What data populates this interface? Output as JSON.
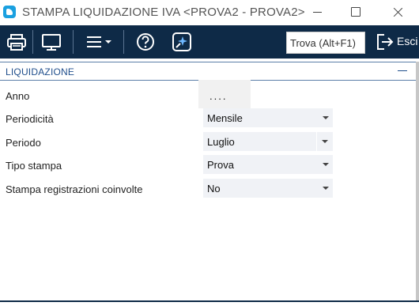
{
  "window": {
    "title": "STAMPA LIQUIDAZIONE IVA <PROVA2 - PROVA2>"
  },
  "toolbar": {
    "buttons": [
      {
        "icon": "printer-icon"
      },
      {
        "icon": "monitor-icon"
      },
      {
        "icon": "menu-icon"
      },
      {
        "icon": "help-icon"
      },
      {
        "icon": "magic-icon"
      }
    ],
    "search_placeholder": "Trova (Alt+F1)",
    "exit_label": "Esci"
  },
  "section": {
    "title": "LIQUIDAZIONE"
  },
  "form": {
    "anno": {
      "label": "Anno",
      "value": "...."
    },
    "periodicita": {
      "label": "Periodicità",
      "value": "Mensile"
    },
    "periodo": {
      "label": "Periodo",
      "value": "Luglio"
    },
    "tipo_stampa": {
      "label": "Tipo stampa",
      "value": "Prova"
    },
    "stampa_registrazioni": {
      "label": "Stampa registrazioni coinvolte",
      "value": "No"
    }
  },
  "colors": {
    "toolbar_bg": "#0e2a47",
    "section_text": "#1f4e8c",
    "field_bg": "#f0f2f6"
  }
}
